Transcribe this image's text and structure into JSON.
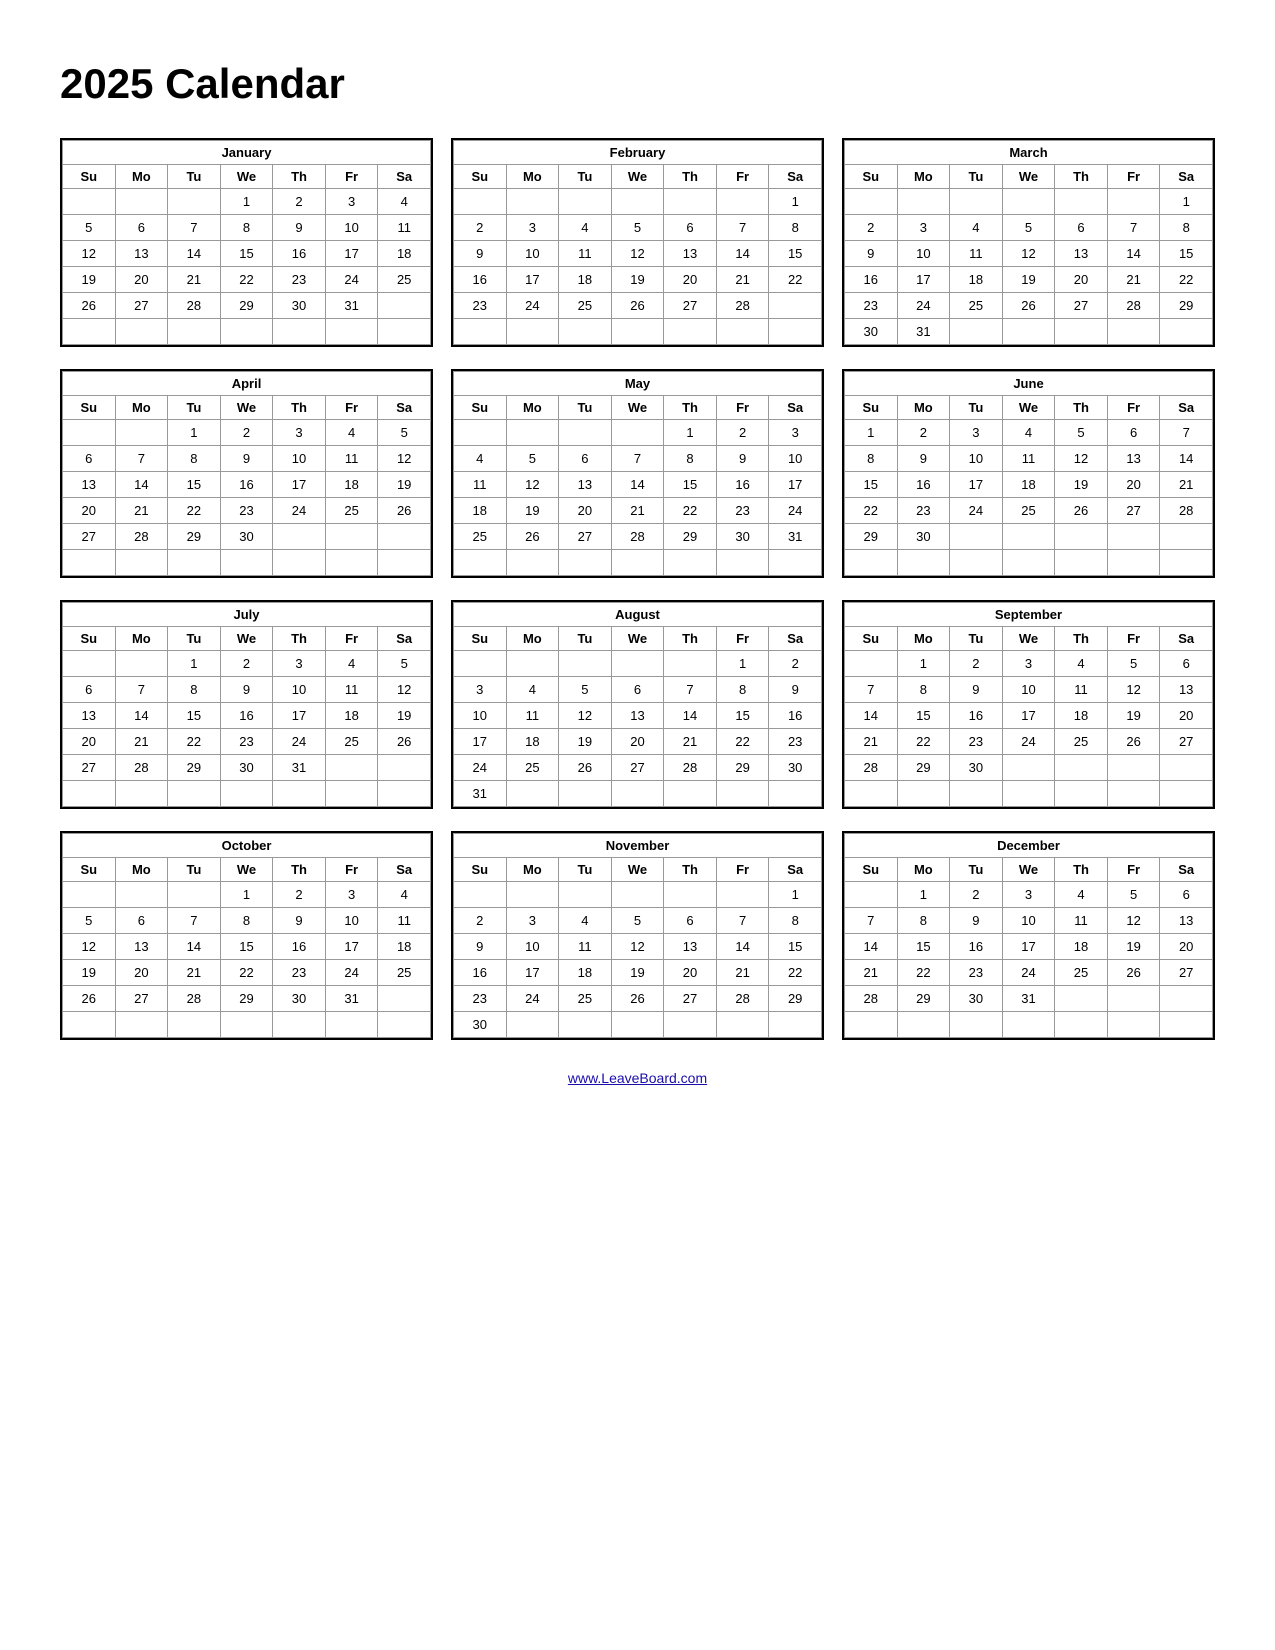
{
  "title": "2025 Calendar",
  "footer_link": "www.LeaveBoard.com",
  "months": [
    {
      "name": "January",
      "days_header": [
        "Su",
        "Mo",
        "Tu",
        "We",
        "Th",
        "Fr",
        "Sa"
      ],
      "weeks": [
        [
          "",
          "",
          "",
          "1",
          "2",
          "3",
          "4"
        ],
        [
          "5",
          "6",
          "7",
          "8",
          "9",
          "10",
          "11"
        ],
        [
          "12",
          "13",
          "14",
          "15",
          "16",
          "17",
          "18"
        ],
        [
          "19",
          "20",
          "21",
          "22",
          "23",
          "24",
          "25"
        ],
        [
          "26",
          "27",
          "28",
          "29",
          "30",
          "31",
          ""
        ],
        [
          "",
          "",
          "",
          "",
          "",
          "",
          ""
        ]
      ]
    },
    {
      "name": "February",
      "days_header": [
        "Su",
        "Mo",
        "Tu",
        "We",
        "Th",
        "Fr",
        "Sa"
      ],
      "weeks": [
        [
          "",
          "",
          "",
          "",
          "",
          "",
          "1"
        ],
        [
          "2",
          "3",
          "4",
          "5",
          "6",
          "7",
          "8"
        ],
        [
          "9",
          "10",
          "11",
          "12",
          "13",
          "14",
          "15"
        ],
        [
          "16",
          "17",
          "18",
          "19",
          "20",
          "21",
          "22"
        ],
        [
          "23",
          "24",
          "25",
          "26",
          "27",
          "28",
          ""
        ],
        [
          "",
          "",
          "",
          "",
          "",
          "",
          ""
        ]
      ]
    },
    {
      "name": "March",
      "days_header": [
        "Su",
        "Mo",
        "Tu",
        "We",
        "Th",
        "Fr",
        "Sa"
      ],
      "weeks": [
        [
          "",
          "",
          "",
          "",
          "",
          "",
          "1"
        ],
        [
          "2",
          "3",
          "4",
          "5",
          "6",
          "7",
          "8"
        ],
        [
          "9",
          "10",
          "11",
          "12",
          "13",
          "14",
          "15"
        ],
        [
          "16",
          "17",
          "18",
          "19",
          "20",
          "21",
          "22"
        ],
        [
          "23",
          "24",
          "25",
          "26",
          "27",
          "28",
          "29"
        ],
        [
          "30",
          "31",
          "",
          "",
          "",
          "",
          ""
        ]
      ]
    },
    {
      "name": "April",
      "days_header": [
        "Su",
        "Mo",
        "Tu",
        "We",
        "Th",
        "Fr",
        "Sa"
      ],
      "weeks": [
        [
          "",
          "",
          "1",
          "2",
          "3",
          "4",
          "5"
        ],
        [
          "6",
          "7",
          "8",
          "9",
          "10",
          "11",
          "12"
        ],
        [
          "13",
          "14",
          "15",
          "16",
          "17",
          "18",
          "19"
        ],
        [
          "20",
          "21",
          "22",
          "23",
          "24",
          "25",
          "26"
        ],
        [
          "27",
          "28",
          "29",
          "30",
          "",
          "",
          ""
        ],
        [
          "",
          "",
          "",
          "",
          "",
          "",
          ""
        ]
      ]
    },
    {
      "name": "May",
      "days_header": [
        "Su",
        "Mo",
        "Tu",
        "We",
        "Th",
        "Fr",
        "Sa"
      ],
      "weeks": [
        [
          "",
          "",
          "",
          "",
          "1",
          "2",
          "3"
        ],
        [
          "4",
          "5",
          "6",
          "7",
          "8",
          "9",
          "10"
        ],
        [
          "11",
          "12",
          "13",
          "14",
          "15",
          "16",
          "17"
        ],
        [
          "18",
          "19",
          "20",
          "21",
          "22",
          "23",
          "24"
        ],
        [
          "25",
          "26",
          "27",
          "28",
          "29",
          "30",
          "31"
        ],
        [
          "",
          "",
          "",
          "",
          "",
          "",
          ""
        ]
      ]
    },
    {
      "name": "June",
      "days_header": [
        "Su",
        "Mo",
        "Tu",
        "We",
        "Th",
        "Fr",
        "Sa"
      ],
      "weeks": [
        [
          "1",
          "2",
          "3",
          "4",
          "5",
          "6",
          "7"
        ],
        [
          "8",
          "9",
          "10",
          "11",
          "12",
          "13",
          "14"
        ],
        [
          "15",
          "16",
          "17",
          "18",
          "19",
          "20",
          "21"
        ],
        [
          "22",
          "23",
          "24",
          "25",
          "26",
          "27",
          "28"
        ],
        [
          "29",
          "30",
          "",
          "",
          "",
          "",
          ""
        ],
        [
          "",
          "",
          "",
          "",
          "",
          "",
          ""
        ]
      ]
    },
    {
      "name": "July",
      "days_header": [
        "Su",
        "Mo",
        "Tu",
        "We",
        "Th",
        "Fr",
        "Sa"
      ],
      "weeks": [
        [
          "",
          "",
          "1",
          "2",
          "3",
          "4",
          "5"
        ],
        [
          "6",
          "7",
          "8",
          "9",
          "10",
          "11",
          "12"
        ],
        [
          "13",
          "14",
          "15",
          "16",
          "17",
          "18",
          "19"
        ],
        [
          "20",
          "21",
          "22",
          "23",
          "24",
          "25",
          "26"
        ],
        [
          "27",
          "28",
          "29",
          "30",
          "31",
          "",
          ""
        ],
        [
          "",
          "",
          "",
          "",
          "",
          "",
          ""
        ]
      ]
    },
    {
      "name": "August",
      "days_header": [
        "Su",
        "Mo",
        "Tu",
        "We",
        "Th",
        "Fr",
        "Sa"
      ],
      "weeks": [
        [
          "",
          "",
          "",
          "",
          "",
          "1",
          "2"
        ],
        [
          "3",
          "4",
          "5",
          "6",
          "7",
          "8",
          "9"
        ],
        [
          "10",
          "11",
          "12",
          "13",
          "14",
          "15",
          "16"
        ],
        [
          "17",
          "18",
          "19",
          "20",
          "21",
          "22",
          "23"
        ],
        [
          "24",
          "25",
          "26",
          "27",
          "28",
          "29",
          "30"
        ],
        [
          "31",
          "",
          "",
          "",
          "",
          "",
          ""
        ]
      ]
    },
    {
      "name": "September",
      "days_header": [
        "Su",
        "Mo",
        "Tu",
        "We",
        "Th",
        "Fr",
        "Sa"
      ],
      "weeks": [
        [
          "",
          "1",
          "2",
          "3",
          "4",
          "5",
          "6"
        ],
        [
          "7",
          "8",
          "9",
          "10",
          "11",
          "12",
          "13"
        ],
        [
          "14",
          "15",
          "16",
          "17",
          "18",
          "19",
          "20"
        ],
        [
          "21",
          "22",
          "23",
          "24",
          "25",
          "26",
          "27"
        ],
        [
          "28",
          "29",
          "30",
          "",
          "",
          "",
          ""
        ],
        [
          "",
          "",
          "",
          "",
          "",
          "",
          ""
        ]
      ]
    },
    {
      "name": "October",
      "days_header": [
        "Su",
        "Mo",
        "Tu",
        "We",
        "Th",
        "Fr",
        "Sa"
      ],
      "weeks": [
        [
          "",
          "",
          "",
          "1",
          "2",
          "3",
          "4"
        ],
        [
          "5",
          "6",
          "7",
          "8",
          "9",
          "10",
          "11"
        ],
        [
          "12",
          "13",
          "14",
          "15",
          "16",
          "17",
          "18"
        ],
        [
          "19",
          "20",
          "21",
          "22",
          "23",
          "24",
          "25"
        ],
        [
          "26",
          "27",
          "28",
          "29",
          "30",
          "31",
          ""
        ],
        [
          "",
          "",
          "",
          "",
          "",
          "",
          ""
        ]
      ]
    },
    {
      "name": "November",
      "days_header": [
        "Su",
        "Mo",
        "Tu",
        "We",
        "Th",
        "Fr",
        "Sa"
      ],
      "weeks": [
        [
          "",
          "",
          "",
          "",
          "",
          "",
          "1"
        ],
        [
          "2",
          "3",
          "4",
          "5",
          "6",
          "7",
          "8"
        ],
        [
          "9",
          "10",
          "11",
          "12",
          "13",
          "14",
          "15"
        ],
        [
          "16",
          "17",
          "18",
          "19",
          "20",
          "21",
          "22"
        ],
        [
          "23",
          "24",
          "25",
          "26",
          "27",
          "28",
          "29"
        ],
        [
          "30",
          "",
          "",
          "",
          "",
          "",
          ""
        ]
      ]
    },
    {
      "name": "December",
      "days_header": [
        "Su",
        "Mo",
        "Tu",
        "We",
        "Th",
        "Fr",
        "Sa"
      ],
      "weeks": [
        [
          "",
          "1",
          "2",
          "3",
          "4",
          "5",
          "6"
        ],
        [
          "7",
          "8",
          "9",
          "10",
          "11",
          "12",
          "13"
        ],
        [
          "14",
          "15",
          "16",
          "17",
          "18",
          "19",
          "20"
        ],
        [
          "21",
          "22",
          "23",
          "24",
          "25",
          "26",
          "27"
        ],
        [
          "28",
          "29",
          "30",
          "31",
          "",
          "",
          ""
        ],
        [
          "",
          "",
          "",
          "",
          "",
          "",
          ""
        ]
      ]
    }
  ]
}
